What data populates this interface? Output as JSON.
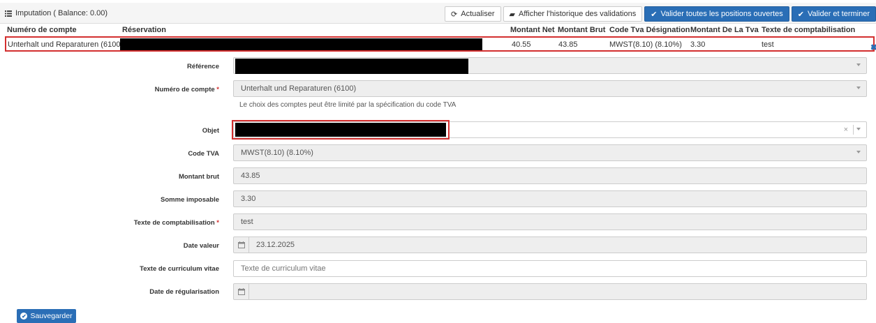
{
  "panel": {
    "title": "Imputation ( Balance: 0.00)"
  },
  "toolbar": {
    "refresh_label": "Actualiser",
    "history_label": "Afficher l'historique des validations",
    "validate_all_label": "Valider toutes les positions ouvertes",
    "validate_finish_label": "Valider et terminer"
  },
  "grid": {
    "headers": {
      "account": "Numéro de compte",
      "reservation": "Réservation",
      "net": "Montant Net",
      "gross": "Montant Brut",
      "vat_code": "Code Tva Désignation",
      "vat_amount": "Montant De La Tva",
      "text": "Texte de comptabilisation"
    },
    "row": {
      "account": "Unterhalt und Reparaturen (6100)",
      "net": "40.55",
      "gross": "43.85",
      "vat_code": "MWST(8.10) (8.10%)",
      "vat_amount": "3.30",
      "text": "test"
    }
  },
  "form": {
    "reference_label": "Référence",
    "account_label": "Numéro de compte",
    "account_value": "Unterhalt und Reparaturen (6100)",
    "account_help": "Le choix des comptes peut être limité par la spécification du code TVA",
    "object_label": "Objet",
    "vat_label": "Code TVA",
    "vat_value": "MWST(8.10) (8.10%)",
    "gross_label": "Montant brut",
    "gross_value": "43.85",
    "taxable_label": "Somme imposable",
    "taxable_value": "3.30",
    "posting_text_label": "Texte de comptabilisation",
    "posting_text_value": "test",
    "value_date_label": "Date valeur",
    "value_date_value": "23.12.2025",
    "cv_text_label": "Texte de curriculum vitae",
    "cv_text_placeholder": "Texte de curriculum vitae",
    "regularisation_label": "Date de régularisation",
    "required_mark": "*",
    "save_label": "Sauvegarder"
  },
  "colors": {
    "accent": "#2a6eb6",
    "highlight": "#d32f2f"
  }
}
